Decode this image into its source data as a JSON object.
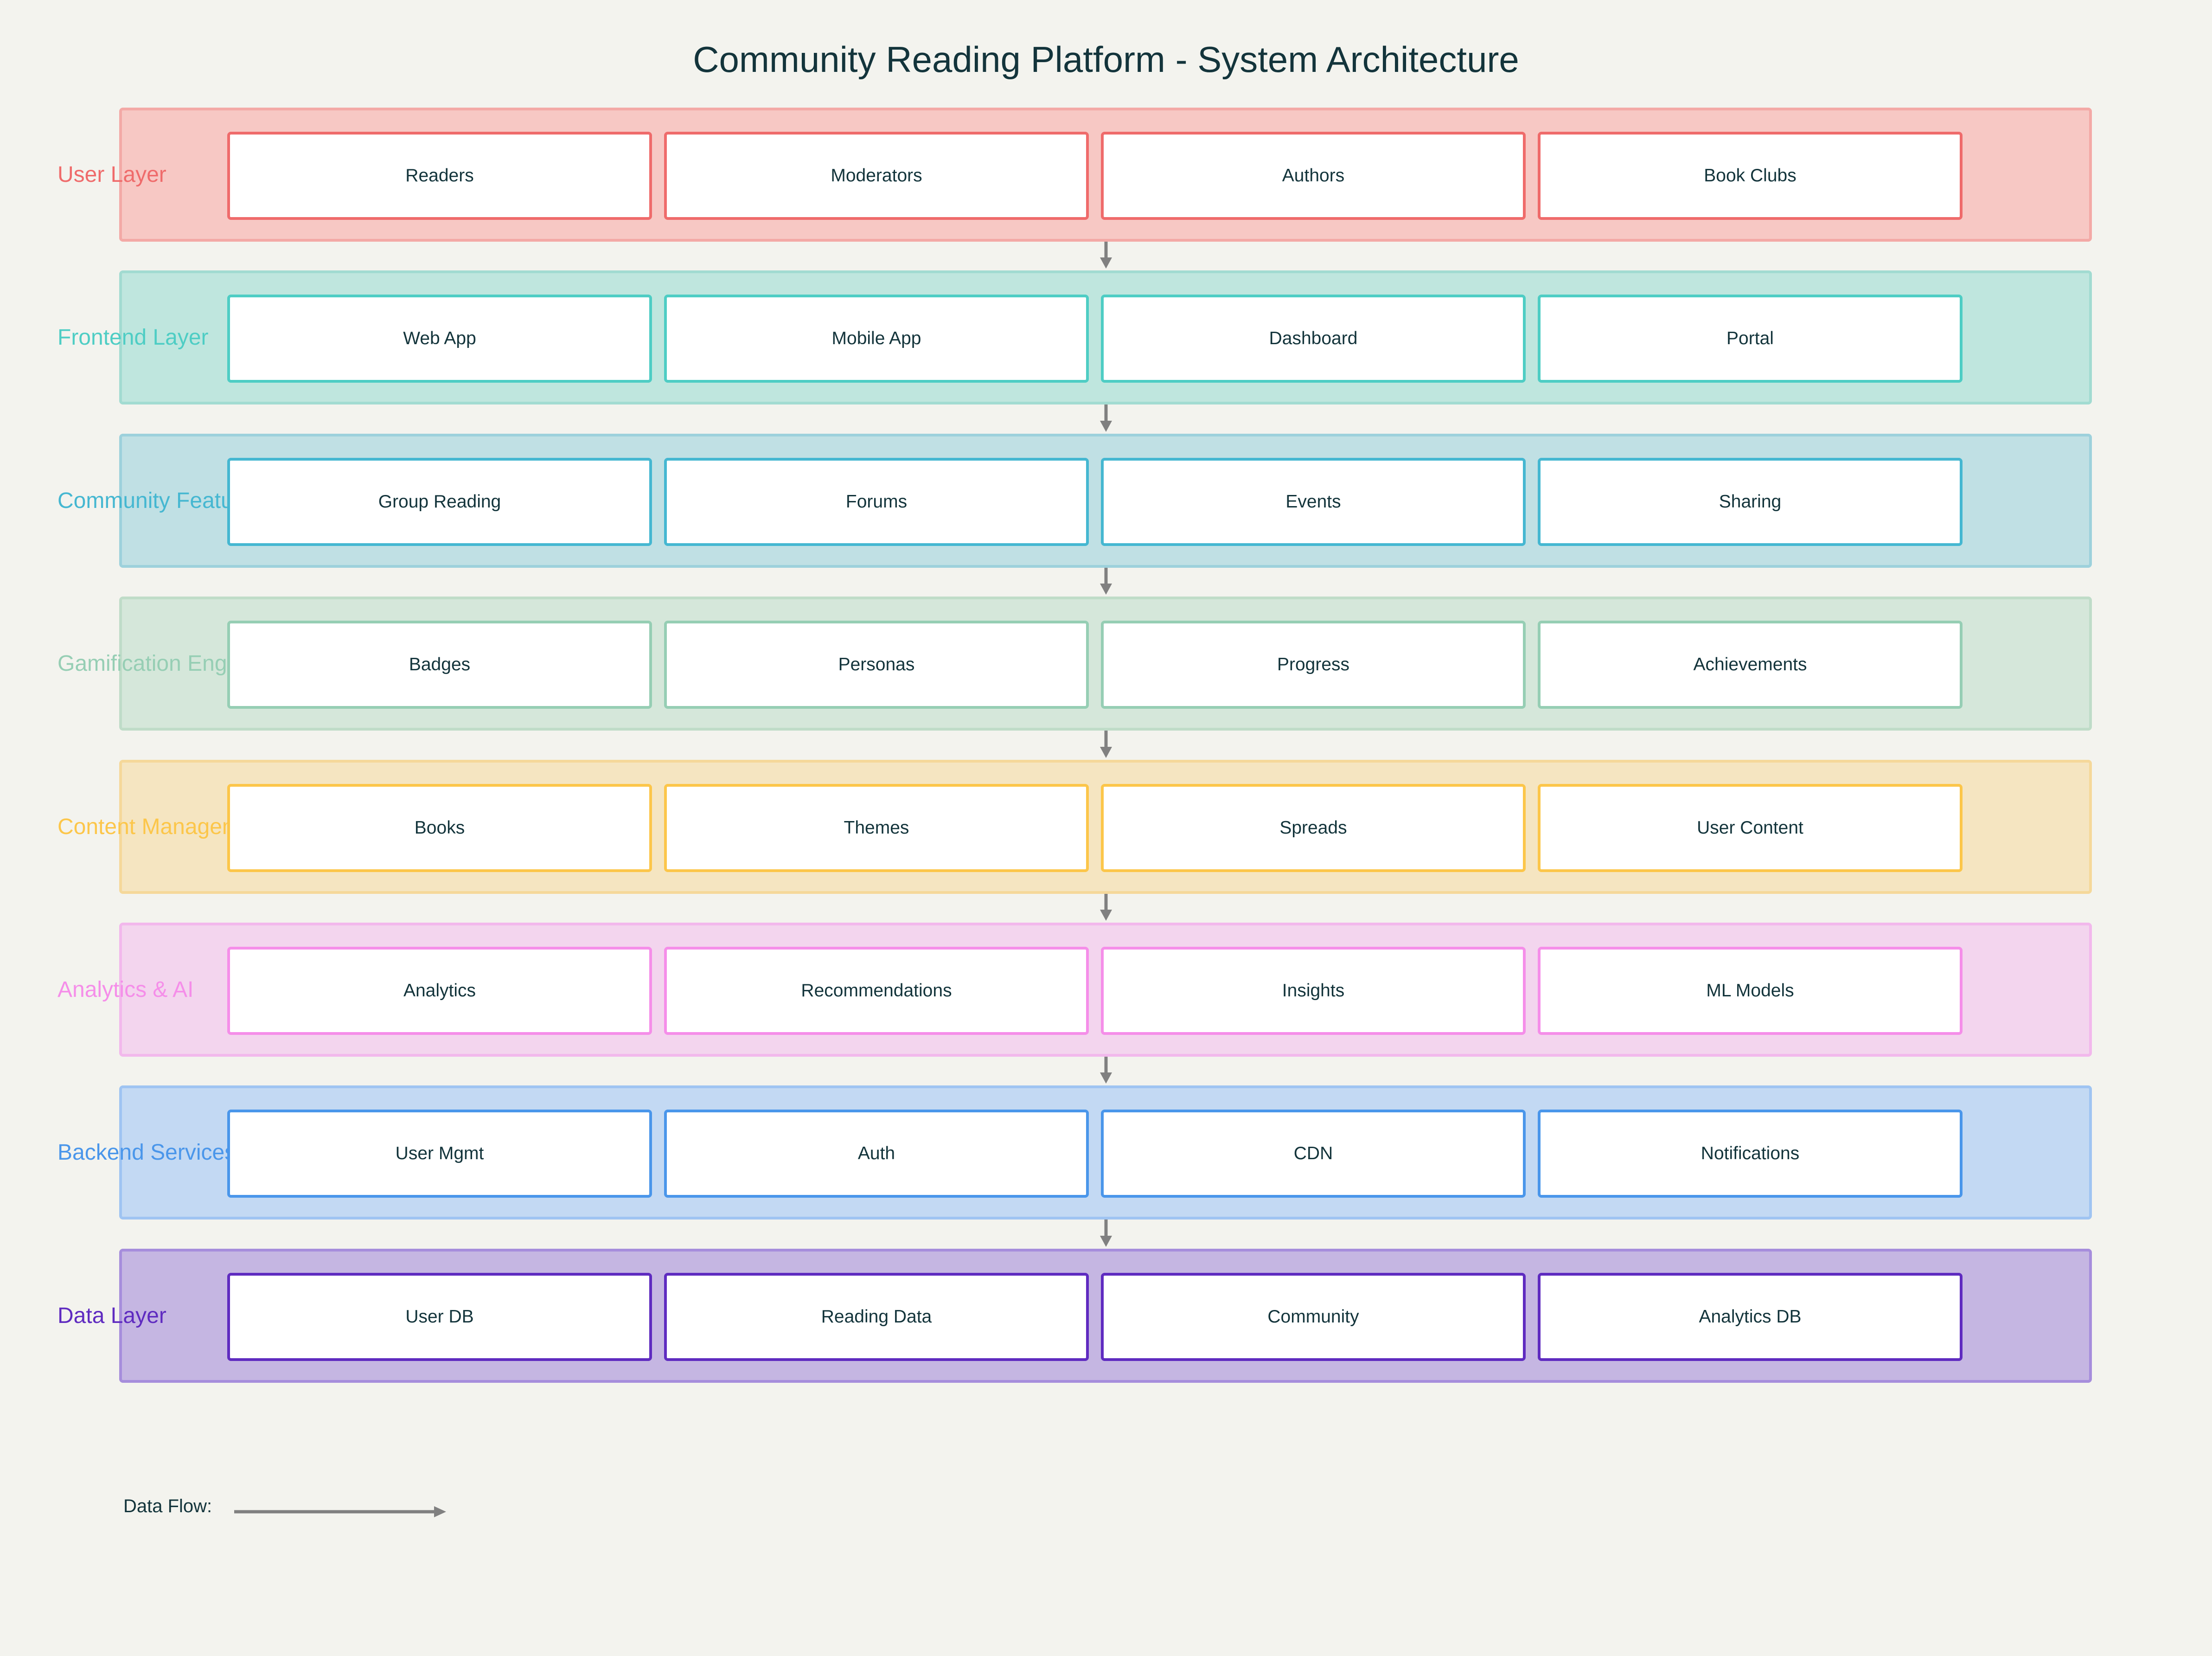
{
  "title": "Community Reading Platform - System Architecture",
  "layers": [
    {
      "name": "User Layer",
      "fill": "#f7c8c4",
      "border": "#f3a9a6",
      "accent": "#ef6b6b",
      "components": [
        "Readers",
        "Moderators",
        "Authors",
        "Book Clubs"
      ]
    },
    {
      "name": "Frontend Layer",
      "fill": "#bfe6de",
      "border": "#a2dbd1",
      "accent": "#4ecdc4",
      "components": [
        "Web App",
        "Mobile App",
        "Dashboard",
        "Portal"
      ]
    },
    {
      "name": "Community Features",
      "fill": "#c0e0e4",
      "border": "#9dd1dc",
      "accent": "#45b7d1",
      "components": [
        "Group Reading",
        "Forums",
        "Events",
        "Sharing"
      ]
    },
    {
      "name": "Gamification Engine",
      "fill": "#d5e7da",
      "border": "#bfdcc8",
      "accent": "#96ceb4",
      "components": [
        "Badges",
        "Personas",
        "Progress",
        "Achievements"
      ]
    },
    {
      "name": "Content Management",
      "fill": "#f5e5c1",
      "border": "#f5d89a",
      "accent": "#fcc64a",
      "components": [
        "Books",
        "Themes",
        "Spreads",
        "User Content"
      ]
    },
    {
      "name": "Analytics & AI",
      "fill": "#f3d5ee",
      "border": "#f2b8ec",
      "accent": "#f58ee9",
      "components": [
        "Analytics",
        "Recommendations",
        "Insights",
        "ML Models"
      ]
    },
    {
      "name": "Backend Services",
      "fill": "#c3d9f3",
      "border": "#9fc4f2",
      "accent": "#4a96ea",
      "components": [
        "User Mgmt",
        "Auth",
        "CDN",
        "Notifications"
      ]
    },
    {
      "name": "Data Layer",
      "fill": "#c5b6e2",
      "border": "#a68ddc",
      "accent": "#5f2bc0",
      "components": [
        "User DB",
        "Reading Data",
        "Community",
        "Analytics DB"
      ]
    }
  ],
  "legend": {
    "label": "Data Flow:",
    "arrow_color": "#808080"
  }
}
